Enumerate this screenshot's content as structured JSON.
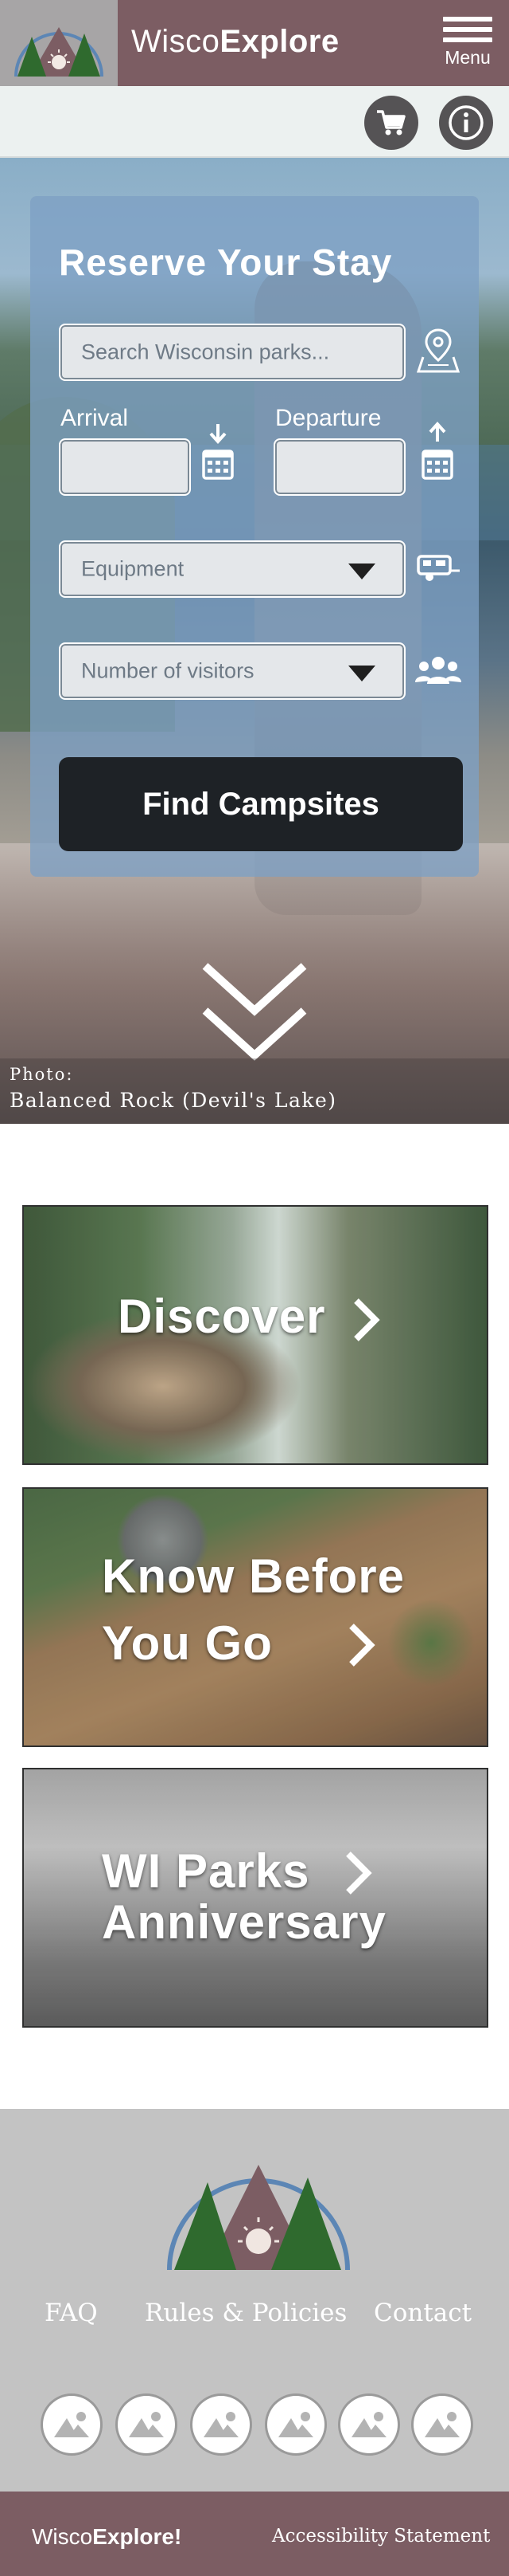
{
  "header": {
    "brand_light": "Wisco",
    "brand_bold": "Explore",
    "menu_label": "Menu"
  },
  "utility": {
    "cart_icon": "cart-icon",
    "info_icon": "info-icon"
  },
  "reserve": {
    "title": "Reserve Your Stay",
    "search_placeholder": "Search Wisconsin parks...",
    "arrival_label": "Arrival",
    "departure_label": "Departure",
    "equipment_label": "Equipment",
    "visitors_label": "Number of visitors",
    "find_button": "Find Campsites"
  },
  "photo": {
    "label": "Photo:",
    "name": "Balanced Rock (Devil's Lake)"
  },
  "cards": [
    {
      "line1": "Discover",
      "line2": ""
    },
    {
      "line1": "Know Before",
      "line2": "You Go"
    },
    {
      "line1": "WI Parks",
      "line2": "Anniversary"
    }
  ],
  "footer": {
    "links": [
      "FAQ",
      "Rules & Policies",
      "Contact"
    ],
    "social_icons": [
      "image-icon",
      "image-icon",
      "image-icon",
      "image-icon",
      "image-icon",
      "image-icon"
    ]
  },
  "bottom_bar": {
    "brand_light": "Wisco",
    "brand_bold": "Explore!",
    "accessibility": "Accessibility Statement"
  },
  "colors": {
    "brand": "#7c5d63",
    "logo_bg": "#a7a5a6",
    "panel": "#7ea0c4",
    "button": "#1e2226",
    "footer": "#c3c3c3"
  }
}
